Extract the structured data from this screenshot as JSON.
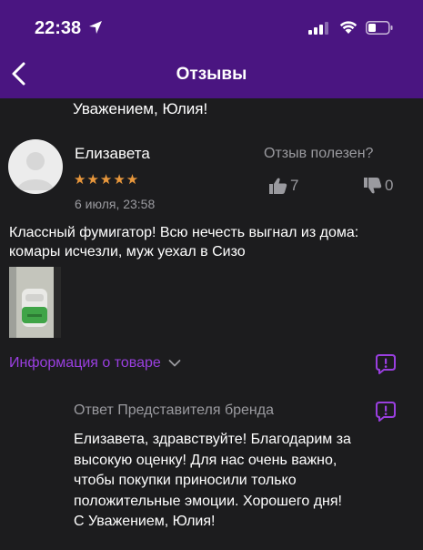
{
  "status_bar": {
    "time": "22:38"
  },
  "header": {
    "title": "Отзывы"
  },
  "previous_review": {
    "tail_text": "Уважением, Юлия!"
  },
  "review": {
    "author": "Елизавета",
    "stars": "★★★★★",
    "date": "6 июля, 23:58",
    "helpful_label": "Отзыв полезен?",
    "likes": "7",
    "dislikes": "0",
    "text": "Классный фумигатор! Всю нечесть выгнал из дома: комары исчезли, муж уехал в Сизо",
    "product_info_label": "Информация о товаре"
  },
  "brand_reply": {
    "title": "Ответ Представителя бренда",
    "lines": [
      "Елизавета, здравствуйте! Благодарим за",
      "высокую оценку! Для нас очень важно,",
      "чтобы покупки приносили только",
      "положительные эмоции. Хорошего дня!",
      "С Уважением, Юлия!"
    ]
  },
  "colors": {
    "header_bg": "#4a1581",
    "page_bg": "#1c1c1e",
    "accent": "#9a3fe0",
    "star": "#e8973c",
    "muted_text": "#9a9a9f"
  },
  "icons": [
    "location-arrow-icon",
    "signal-icon",
    "wifi-icon",
    "battery-icon",
    "back-chevron-icon",
    "thumbs-up-icon",
    "thumbs-down-icon",
    "chevron-down-icon",
    "report-icon"
  ]
}
